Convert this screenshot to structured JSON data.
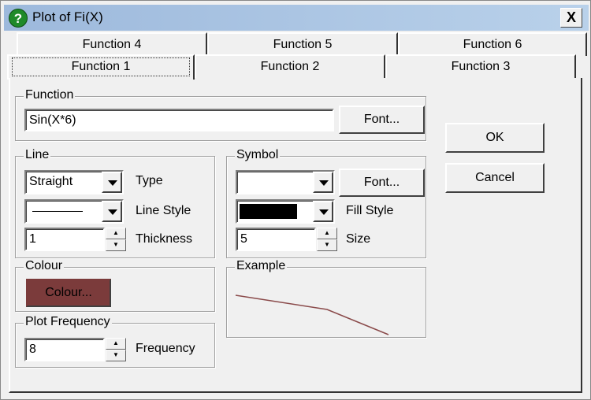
{
  "window": {
    "title": "Plot of Fi(X)",
    "close": "X"
  },
  "tabs": {
    "back": [
      "Function 4",
      "Function 5",
      "Function 6"
    ],
    "front": [
      "Function 1",
      "Function 2",
      "Function 3"
    ],
    "active": "Function 1"
  },
  "function": {
    "legend": "Function",
    "value": "Sin(X*6)",
    "font_button": "Font..."
  },
  "line": {
    "legend": "Line",
    "type_value": "Straight",
    "type_label": "Type",
    "style_label": "Line Style",
    "thickness_value": "1",
    "thickness_label": "Thickness"
  },
  "symbol": {
    "legend": "Symbol",
    "symbol_value": "",
    "font_button": "Font...",
    "fill_label": "Fill Style",
    "size_value": "5",
    "size_label": "Size"
  },
  "colour": {
    "legend": "Colour",
    "button": "Colour...",
    "color": "#7b3b3b"
  },
  "plot_frequency": {
    "legend": "Plot Frequency",
    "value": "8",
    "label": "Frequency"
  },
  "example": {
    "legend": "Example",
    "line_color": "#8a4a4a"
  },
  "buttons": {
    "ok": "OK",
    "cancel": "Cancel"
  }
}
